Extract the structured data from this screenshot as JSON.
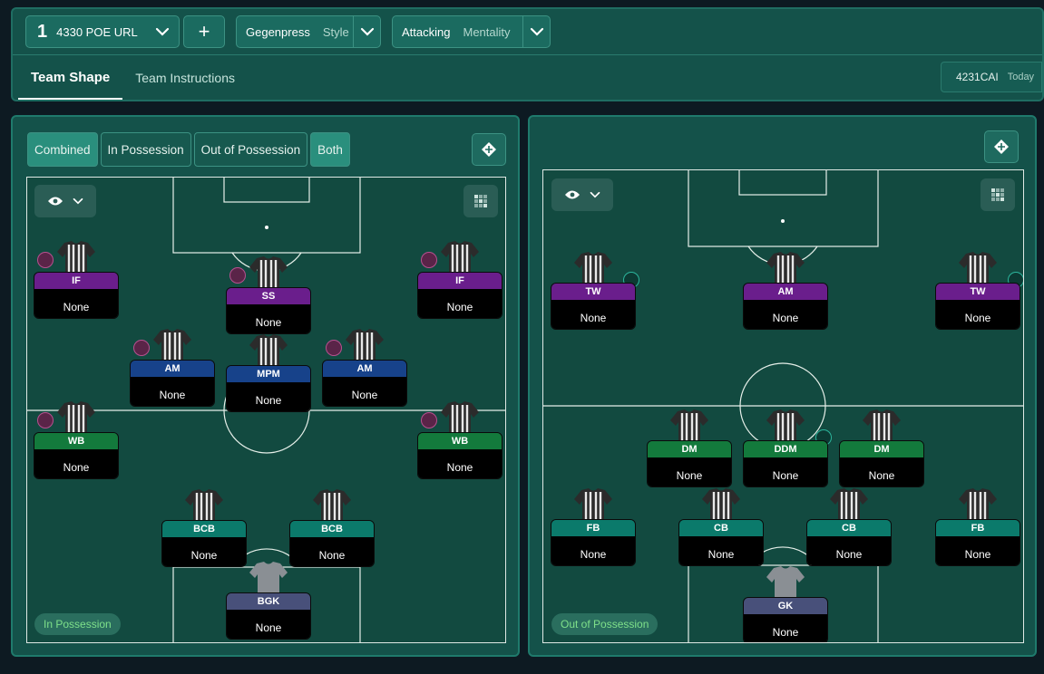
{
  "header": {
    "tactic_number": "1",
    "tactic_name": "4330 POE URL",
    "add_label": "+",
    "style_value": "Gegenpress",
    "style_label": "Style",
    "mentality_value": "Attacking",
    "mentality_label": "Mentality",
    "tabs": [
      {
        "label": "Team Shape"
      },
      {
        "label": "Team Instructions"
      }
    ],
    "saved_name": "4231CAI",
    "saved_when": "Today"
  },
  "left": {
    "phases": [
      {
        "label": "Combined"
      },
      {
        "label": "In Possession"
      },
      {
        "label": "Out of Possession"
      },
      {
        "label": "Both"
      }
    ],
    "badge": "In Possession",
    "players": [
      {
        "role": "IF",
        "duty": "None"
      },
      {
        "role": "SS",
        "duty": "None"
      },
      {
        "role": "IF",
        "duty": "None"
      },
      {
        "role": "AM",
        "duty": "None"
      },
      {
        "role": "MPM",
        "duty": "None"
      },
      {
        "role": "AM",
        "duty": "None"
      },
      {
        "role": "WB",
        "duty": "None"
      },
      {
        "role": "WB",
        "duty": "None"
      },
      {
        "role": "BCB",
        "duty": "None"
      },
      {
        "role": "BCB",
        "duty": "None"
      },
      {
        "role": "BGK",
        "duty": "None"
      }
    ]
  },
  "right": {
    "badge": "Out of Possession",
    "players": [
      {
        "role": "TW",
        "duty": "None"
      },
      {
        "role": "AM",
        "duty": "None"
      },
      {
        "role": "TW",
        "duty": "None"
      },
      {
        "role": "DM",
        "duty": "None"
      },
      {
        "role": "DDM",
        "duty": "None"
      },
      {
        "role": "DM",
        "duty": "None"
      },
      {
        "role": "FB",
        "duty": "None"
      },
      {
        "role": "CB",
        "duty": "None"
      },
      {
        "role": "CB",
        "duty": "None"
      },
      {
        "role": "FB",
        "duty": "None"
      },
      {
        "role": "GK",
        "duty": "None"
      }
    ]
  },
  "icons": {
    "dropdown": "chevron-down-icon",
    "eye": "eye-icon",
    "grid": "grid-icon",
    "pitch": "pitch-icon"
  },
  "colors": {
    "panel": "#14524a",
    "pitch": "#124a40",
    "attack": "#6a1e8c",
    "midfield": "#17428a",
    "wide": "#137a3c",
    "defence": "#0b7a6b",
    "keeper": "#48507a"
  }
}
